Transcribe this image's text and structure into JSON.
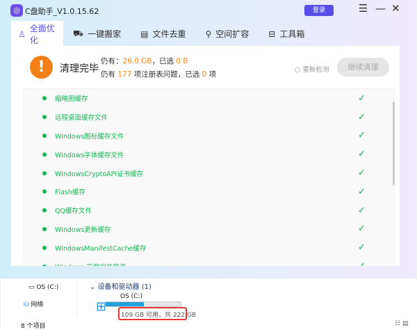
{
  "app": {
    "title": "C盘助手_V1.0.15.62",
    "login": "登录",
    "accent": "#5a4ee6"
  },
  "tabs": [
    {
      "label": "全面优化",
      "icon": "rocket-icon"
    },
    {
      "label": "一键搬家",
      "icon": "truck-icon"
    },
    {
      "label": "文件去重",
      "icon": "file-icon"
    },
    {
      "label": "空间扩容",
      "icon": "expand-icon"
    },
    {
      "label": "工具箱",
      "icon": "toolbox-icon"
    }
  ],
  "status": {
    "title": "清理完毕",
    "remain_label": "仍有：",
    "remain_size": "26.0 GB",
    "selected_label": "，已选",
    "selected_size": "0 B",
    "reg_prefix": "仍有",
    "reg_count": "177",
    "reg_mid": "项注册表问题，已选",
    "reg_sel": "0",
    "reg_suffix": "项",
    "recheck": "重新检测",
    "continue": "继续清理"
  },
  "items": [
    "缩略图缓存",
    "远程桌面缓存文件",
    "Windows图标缓存文件",
    "Windows字体缓存文件",
    "WindowsCryptoAPI证书缓存",
    "Flash缓存",
    "QQ缓存文件",
    "Windows更新缓存",
    "WindowsManifestCache缓存",
    "Windows 下载安装目录"
  ],
  "explorer": {
    "side_drive": "OS (C:)",
    "side_network": "网络",
    "section": "设备和驱动器 (1)",
    "drive_name": "OS (C:)",
    "drive_info": "109 GB 可用，共 222 GB",
    "used_fraction": 0.51,
    "count": "8 个项目"
  }
}
